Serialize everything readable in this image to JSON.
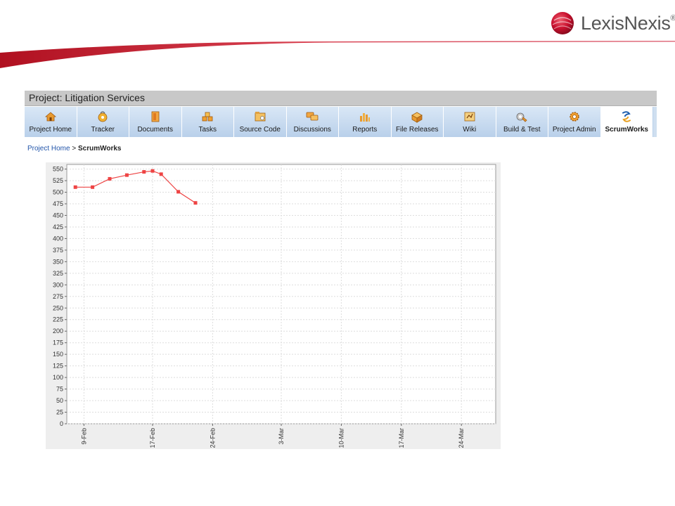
{
  "brand": {
    "name": "LexisNexis",
    "mark": "®",
    "accent_color": "#c8102e"
  },
  "project": {
    "title": "Project: Litigation Services"
  },
  "tabs": [
    {
      "label": "Project Home",
      "icon": "house-icon"
    },
    {
      "label": "Tracker",
      "icon": "tracker-icon"
    },
    {
      "label": "Documents",
      "icon": "document-icon"
    },
    {
      "label": "Tasks",
      "icon": "tasks-icon"
    },
    {
      "label": "Source Code",
      "icon": "source-code-icon"
    },
    {
      "label": "Discussions",
      "icon": "discussion-icon"
    },
    {
      "label": "Reports",
      "icon": "reports-icon"
    },
    {
      "label": "File Releases",
      "icon": "file-releases-icon"
    },
    {
      "label": "Wiki",
      "icon": "wiki-icon"
    },
    {
      "label": "Build & Test",
      "icon": "build-test-icon"
    },
    {
      "label": "Project Admin",
      "icon": "gear-icon"
    },
    {
      "label": "ScrumWorks",
      "icon": "scrumworks-icon",
      "active": true
    }
  ],
  "breadcrumb": {
    "home": "Project Home",
    "separator": ">",
    "current": "ScrumWorks"
  },
  "chart_data": {
    "type": "line",
    "title": "",
    "xlabel": "",
    "ylabel": "",
    "ylim": [
      0,
      560
    ],
    "y_ticks": [
      0,
      25,
      50,
      75,
      100,
      125,
      150,
      175,
      200,
      225,
      250,
      275,
      300,
      325,
      350,
      375,
      400,
      425,
      450,
      475,
      500,
      525,
      550
    ],
    "x_tick_labels": [
      "9-Feb",
      "17-Feb",
      "24-Feb",
      "3-Mar",
      "10-Mar",
      "17-Mar",
      "24-Mar"
    ],
    "x_range_days": [
      "7-Feb",
      "28-Mar"
    ],
    "grid": true,
    "series_color": "#ee4444",
    "series": [
      {
        "x": [
          "8-Feb",
          "10-Feb",
          "12-Feb",
          "14-Feb",
          "16-Feb",
          "17-Feb",
          "18-Feb",
          "20-Feb",
          "22-Feb"
        ],
        "values": [
          511,
          511,
          529,
          537,
          544,
          546,
          539,
          501,
          477
        ]
      }
    ]
  }
}
